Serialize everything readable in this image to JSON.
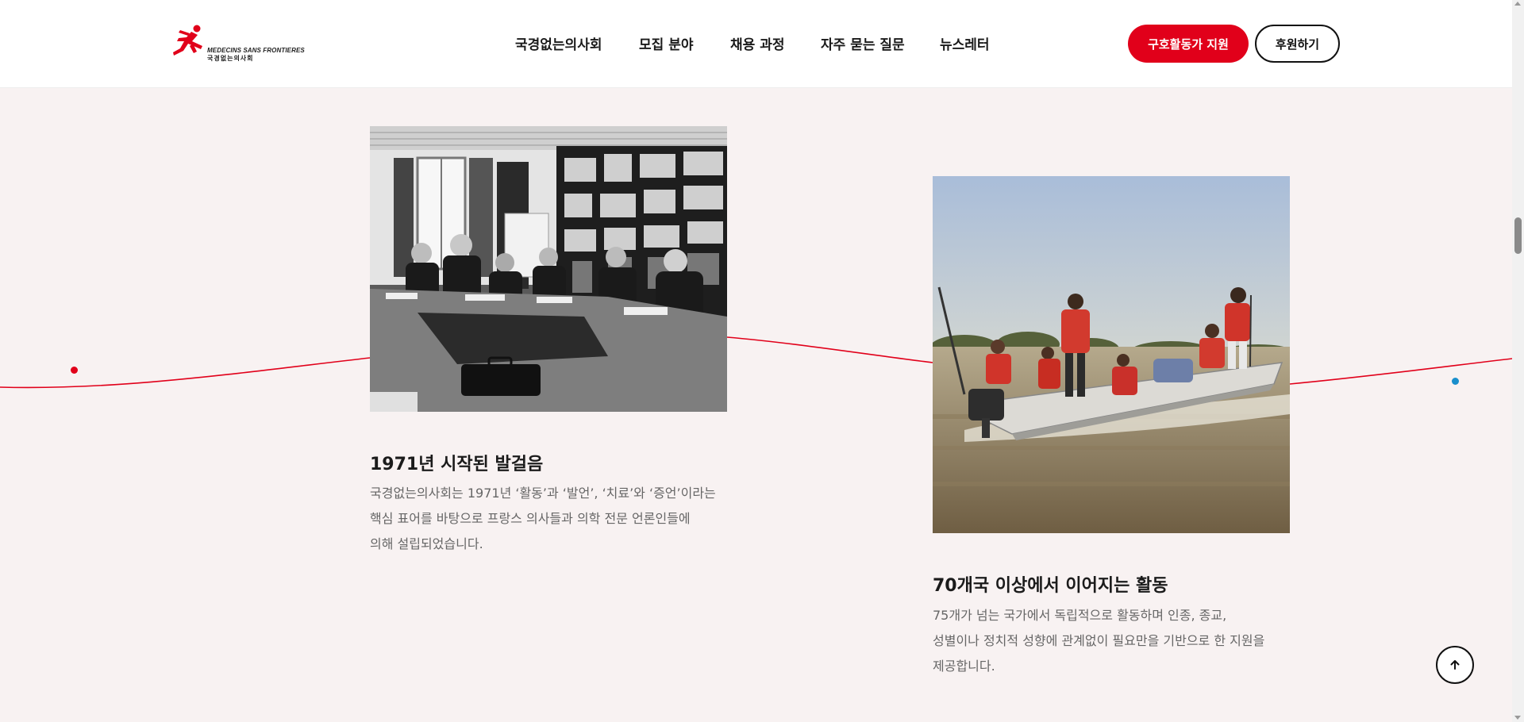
{
  "brand": {
    "logo_text_en": "MEDECINS SANS FRONTIERES",
    "logo_text_ko": "국경없는의사회",
    "accent_color": "#e1001a"
  },
  "nav": {
    "items": [
      "국경없는의사회",
      "모집 분야",
      "채용 과정",
      "자주 묻는 질문",
      "뉴스레터"
    ]
  },
  "header_buttons": {
    "primary": "구호활동가 지원",
    "secondary": "후원하기"
  },
  "cards": [
    {
      "image": "black-and-white-meeting-photo",
      "title": "1971년 시작된 발걸음",
      "desc_lines": [
        "국경없는의사회는 1971년 ‘활동’과 ‘발언’, ‘치료’와 ‘증언’이라는",
        "핵심 표어를 바탕으로 프랑스 의사들과 의학 전문 언론인들에",
        "의해 설립되었습니다."
      ]
    },
    {
      "image": "boat-with-life-jackets-photo",
      "title": "70개국 이상에서 이어지는 활동",
      "desc_lines": [
        "75개가 넘는 국가에서 독립적으로 활동하며 인종, 종교,",
        "성별이나 정치적 성향에 관계없이 필요만을 기반으로 한 지원을",
        "제공합니다."
      ]
    }
  ],
  "scroll_top_icon": "arrow-up-icon"
}
